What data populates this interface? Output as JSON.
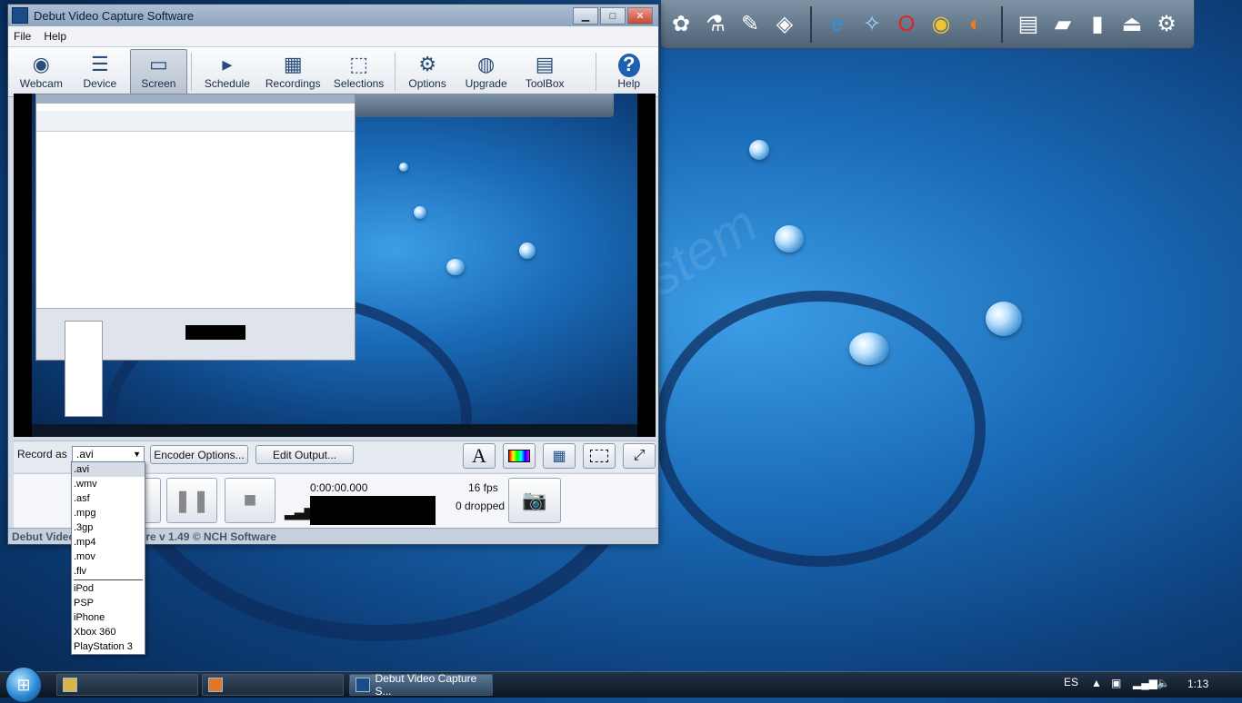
{
  "window": {
    "title": "Debut Video Capture Software",
    "buttons": {
      "minimize": "▁",
      "maximize": "□",
      "close": "✕"
    }
  },
  "menu": [
    "File",
    "Help"
  ],
  "toolbar": [
    {
      "label": "Webcam",
      "icon": "webcam-icon",
      "glyph": "◉"
    },
    {
      "label": "Device",
      "icon": "device-icon",
      "glyph": "☰"
    },
    {
      "label": "Screen",
      "icon": "screen-icon",
      "glyph": "▭",
      "active": true
    },
    {
      "label": "Schedule",
      "icon": "schedule-icon",
      "glyph": "▸"
    },
    {
      "label": "Recordings",
      "icon": "recordings-icon",
      "glyph": "▦"
    },
    {
      "label": "Selections",
      "icon": "selections-icon",
      "glyph": "⬚"
    },
    {
      "label": "Options",
      "icon": "options-icon",
      "glyph": "⚙"
    },
    {
      "label": "Upgrade",
      "icon": "upgrade-icon",
      "glyph": "◍"
    },
    {
      "label": "ToolBox",
      "icon": "toolbox-icon",
      "glyph": "▤"
    },
    {
      "label": "Help",
      "icon": "help-icon",
      "glyph": "?"
    }
  ],
  "controls": {
    "record_as_label": "Record as",
    "selected_format": ".avi",
    "encoder_options": "Encoder Options...",
    "edit_output": "Edit Output..."
  },
  "format_options": [
    ".avi",
    ".wmv",
    ".asf",
    ".mpg",
    ".3gp",
    ".mp4",
    ".mov",
    ".flv",
    "iPod",
    "PSP",
    "iPhone",
    "Xbox 360",
    "PlayStation 3"
  ],
  "recorder": {
    "timer": "0:00:00.000",
    "fps": "16 fps",
    "dropped": "0 dropped"
  },
  "status_bar": {
    "left": "Debut Video",
    "right": "ire v 1.49 © NCH Software"
  },
  "taskbar": {
    "tasks": [
      {
        "label": "",
        "active": false
      },
      {
        "label": "",
        "active": false
      },
      {
        "label": "Debut Video Capture S...",
        "active": true
      }
    ],
    "language": "ES",
    "clock": "1:13"
  }
}
